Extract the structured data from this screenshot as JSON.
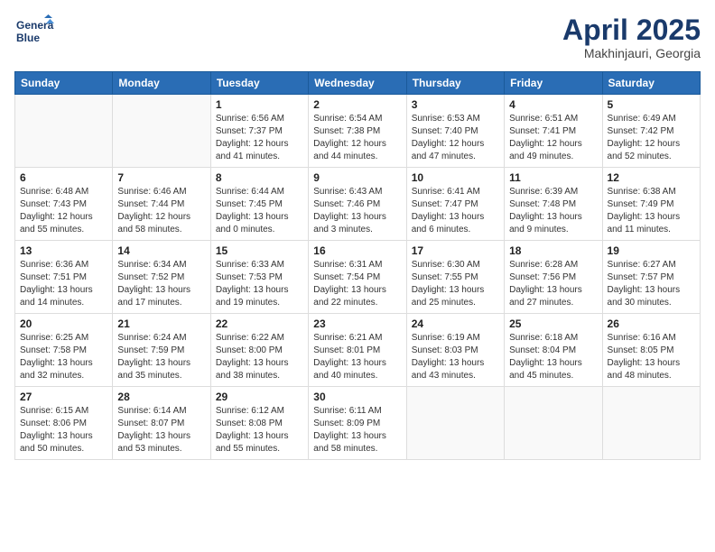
{
  "header": {
    "logo_line1": "General",
    "logo_line2": "Blue",
    "month_title": "April 2025",
    "location": "Makhinjauri, Georgia"
  },
  "weekdays": [
    "Sunday",
    "Monday",
    "Tuesday",
    "Wednesday",
    "Thursday",
    "Friday",
    "Saturday"
  ],
  "weeks": [
    [
      {
        "day": "",
        "info": ""
      },
      {
        "day": "",
        "info": ""
      },
      {
        "day": "1",
        "info": "Sunrise: 6:56 AM\nSunset: 7:37 PM\nDaylight: 12 hours and 41 minutes."
      },
      {
        "day": "2",
        "info": "Sunrise: 6:54 AM\nSunset: 7:38 PM\nDaylight: 12 hours and 44 minutes."
      },
      {
        "day": "3",
        "info": "Sunrise: 6:53 AM\nSunset: 7:40 PM\nDaylight: 12 hours and 47 minutes."
      },
      {
        "day": "4",
        "info": "Sunrise: 6:51 AM\nSunset: 7:41 PM\nDaylight: 12 hours and 49 minutes."
      },
      {
        "day": "5",
        "info": "Sunrise: 6:49 AM\nSunset: 7:42 PM\nDaylight: 12 hours and 52 minutes."
      }
    ],
    [
      {
        "day": "6",
        "info": "Sunrise: 6:48 AM\nSunset: 7:43 PM\nDaylight: 12 hours and 55 minutes."
      },
      {
        "day": "7",
        "info": "Sunrise: 6:46 AM\nSunset: 7:44 PM\nDaylight: 12 hours and 58 minutes."
      },
      {
        "day": "8",
        "info": "Sunrise: 6:44 AM\nSunset: 7:45 PM\nDaylight: 13 hours and 0 minutes."
      },
      {
        "day": "9",
        "info": "Sunrise: 6:43 AM\nSunset: 7:46 PM\nDaylight: 13 hours and 3 minutes."
      },
      {
        "day": "10",
        "info": "Sunrise: 6:41 AM\nSunset: 7:47 PM\nDaylight: 13 hours and 6 minutes."
      },
      {
        "day": "11",
        "info": "Sunrise: 6:39 AM\nSunset: 7:48 PM\nDaylight: 13 hours and 9 minutes."
      },
      {
        "day": "12",
        "info": "Sunrise: 6:38 AM\nSunset: 7:49 PM\nDaylight: 13 hours and 11 minutes."
      }
    ],
    [
      {
        "day": "13",
        "info": "Sunrise: 6:36 AM\nSunset: 7:51 PM\nDaylight: 13 hours and 14 minutes."
      },
      {
        "day": "14",
        "info": "Sunrise: 6:34 AM\nSunset: 7:52 PM\nDaylight: 13 hours and 17 minutes."
      },
      {
        "day": "15",
        "info": "Sunrise: 6:33 AM\nSunset: 7:53 PM\nDaylight: 13 hours and 19 minutes."
      },
      {
        "day": "16",
        "info": "Sunrise: 6:31 AM\nSunset: 7:54 PM\nDaylight: 13 hours and 22 minutes."
      },
      {
        "day": "17",
        "info": "Sunrise: 6:30 AM\nSunset: 7:55 PM\nDaylight: 13 hours and 25 minutes."
      },
      {
        "day": "18",
        "info": "Sunrise: 6:28 AM\nSunset: 7:56 PM\nDaylight: 13 hours and 27 minutes."
      },
      {
        "day": "19",
        "info": "Sunrise: 6:27 AM\nSunset: 7:57 PM\nDaylight: 13 hours and 30 minutes."
      }
    ],
    [
      {
        "day": "20",
        "info": "Sunrise: 6:25 AM\nSunset: 7:58 PM\nDaylight: 13 hours and 32 minutes."
      },
      {
        "day": "21",
        "info": "Sunrise: 6:24 AM\nSunset: 7:59 PM\nDaylight: 13 hours and 35 minutes."
      },
      {
        "day": "22",
        "info": "Sunrise: 6:22 AM\nSunset: 8:00 PM\nDaylight: 13 hours and 38 minutes."
      },
      {
        "day": "23",
        "info": "Sunrise: 6:21 AM\nSunset: 8:01 PM\nDaylight: 13 hours and 40 minutes."
      },
      {
        "day": "24",
        "info": "Sunrise: 6:19 AM\nSunset: 8:03 PM\nDaylight: 13 hours and 43 minutes."
      },
      {
        "day": "25",
        "info": "Sunrise: 6:18 AM\nSunset: 8:04 PM\nDaylight: 13 hours and 45 minutes."
      },
      {
        "day": "26",
        "info": "Sunrise: 6:16 AM\nSunset: 8:05 PM\nDaylight: 13 hours and 48 minutes."
      }
    ],
    [
      {
        "day": "27",
        "info": "Sunrise: 6:15 AM\nSunset: 8:06 PM\nDaylight: 13 hours and 50 minutes."
      },
      {
        "day": "28",
        "info": "Sunrise: 6:14 AM\nSunset: 8:07 PM\nDaylight: 13 hours and 53 minutes."
      },
      {
        "day": "29",
        "info": "Sunrise: 6:12 AM\nSunset: 8:08 PM\nDaylight: 13 hours and 55 minutes."
      },
      {
        "day": "30",
        "info": "Sunrise: 6:11 AM\nSunset: 8:09 PM\nDaylight: 13 hours and 58 minutes."
      },
      {
        "day": "",
        "info": ""
      },
      {
        "day": "",
        "info": ""
      },
      {
        "day": "",
        "info": ""
      }
    ]
  ]
}
